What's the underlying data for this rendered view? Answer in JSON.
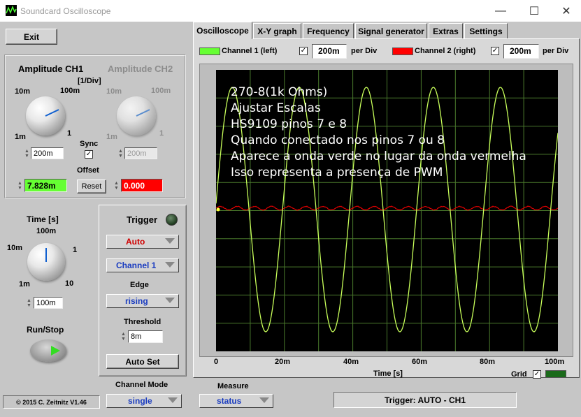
{
  "window": {
    "title": "Soundcard Oscilloscope",
    "min": "—",
    "max": "☐",
    "close": "✕"
  },
  "left": {
    "exit": "Exit",
    "amp_ch1": "Amplitude CH1",
    "amp_ch2": "Amplitude CH2",
    "unit": "[1/Div]",
    "k1": {
      "t10m": "10m",
      "t100m": "100m",
      "t1m": "1m",
      "t1": "1"
    },
    "k2": {
      "t10m": "10m",
      "t100m": "100m",
      "t1m": "1m",
      "t1": "1"
    },
    "ch1_scale": "200m",
    "ch2_scale": "200m",
    "sync": "Sync",
    "offset": "Offset",
    "ch1_offset": "7.828m",
    "reset": "Reset",
    "ch2_offset": "0.000",
    "time": "Time [s]",
    "kt": {
      "t100m": "100m",
      "t10m": "10m",
      "t1": "1",
      "t1m": "1m",
      "t10": "10"
    },
    "time_scale": "100m",
    "run_stop": "Run/Stop",
    "copyright": "© 2015  C. Zeitnitz V1.46",
    "channel_mode_label": "Channel Mode",
    "channel_mode": "single"
  },
  "trigger": {
    "title": "Trigger",
    "mode": "Auto",
    "channel": "Channel 1",
    "edge_label": "Edge",
    "edge": "rising",
    "threshold_label": "Threshold",
    "threshold": "8m",
    "auto_set": "Auto Set"
  },
  "tabs": [
    "Oscilloscope",
    "X-Y graph",
    "Frequency",
    "Signal generator",
    "Extras",
    "Settings"
  ],
  "channels": {
    "ch1_label": "Channel 1 (left)",
    "ch1_div": "200m",
    "per_div": "per Div",
    "ch2_label": "Channel 2 (right)",
    "ch2_div": "200m",
    "ch1_color": "#66ff33",
    "ch2_color": "#ff0000"
  },
  "scope": {
    "lines": [
      "270-8(1k Ohms)",
      "Ajustar Escalas",
      "HS9109 pinos 7 e 8",
      "Quando conectado nos pinos 7 ou 8",
      "Aparece a onda verde no lugar da onda vermelha",
      "Isso representa a presença de PWM"
    ],
    "x_ticks": [
      "0",
      "20m",
      "40m",
      "60m",
      "80m",
      "100m"
    ],
    "x_label": "Time [s]",
    "grid_label": "Grid"
  },
  "bottom": {
    "measure_label": "Measure",
    "measure": "status",
    "trigger_status": "Trigger: AUTO - CH1"
  }
}
